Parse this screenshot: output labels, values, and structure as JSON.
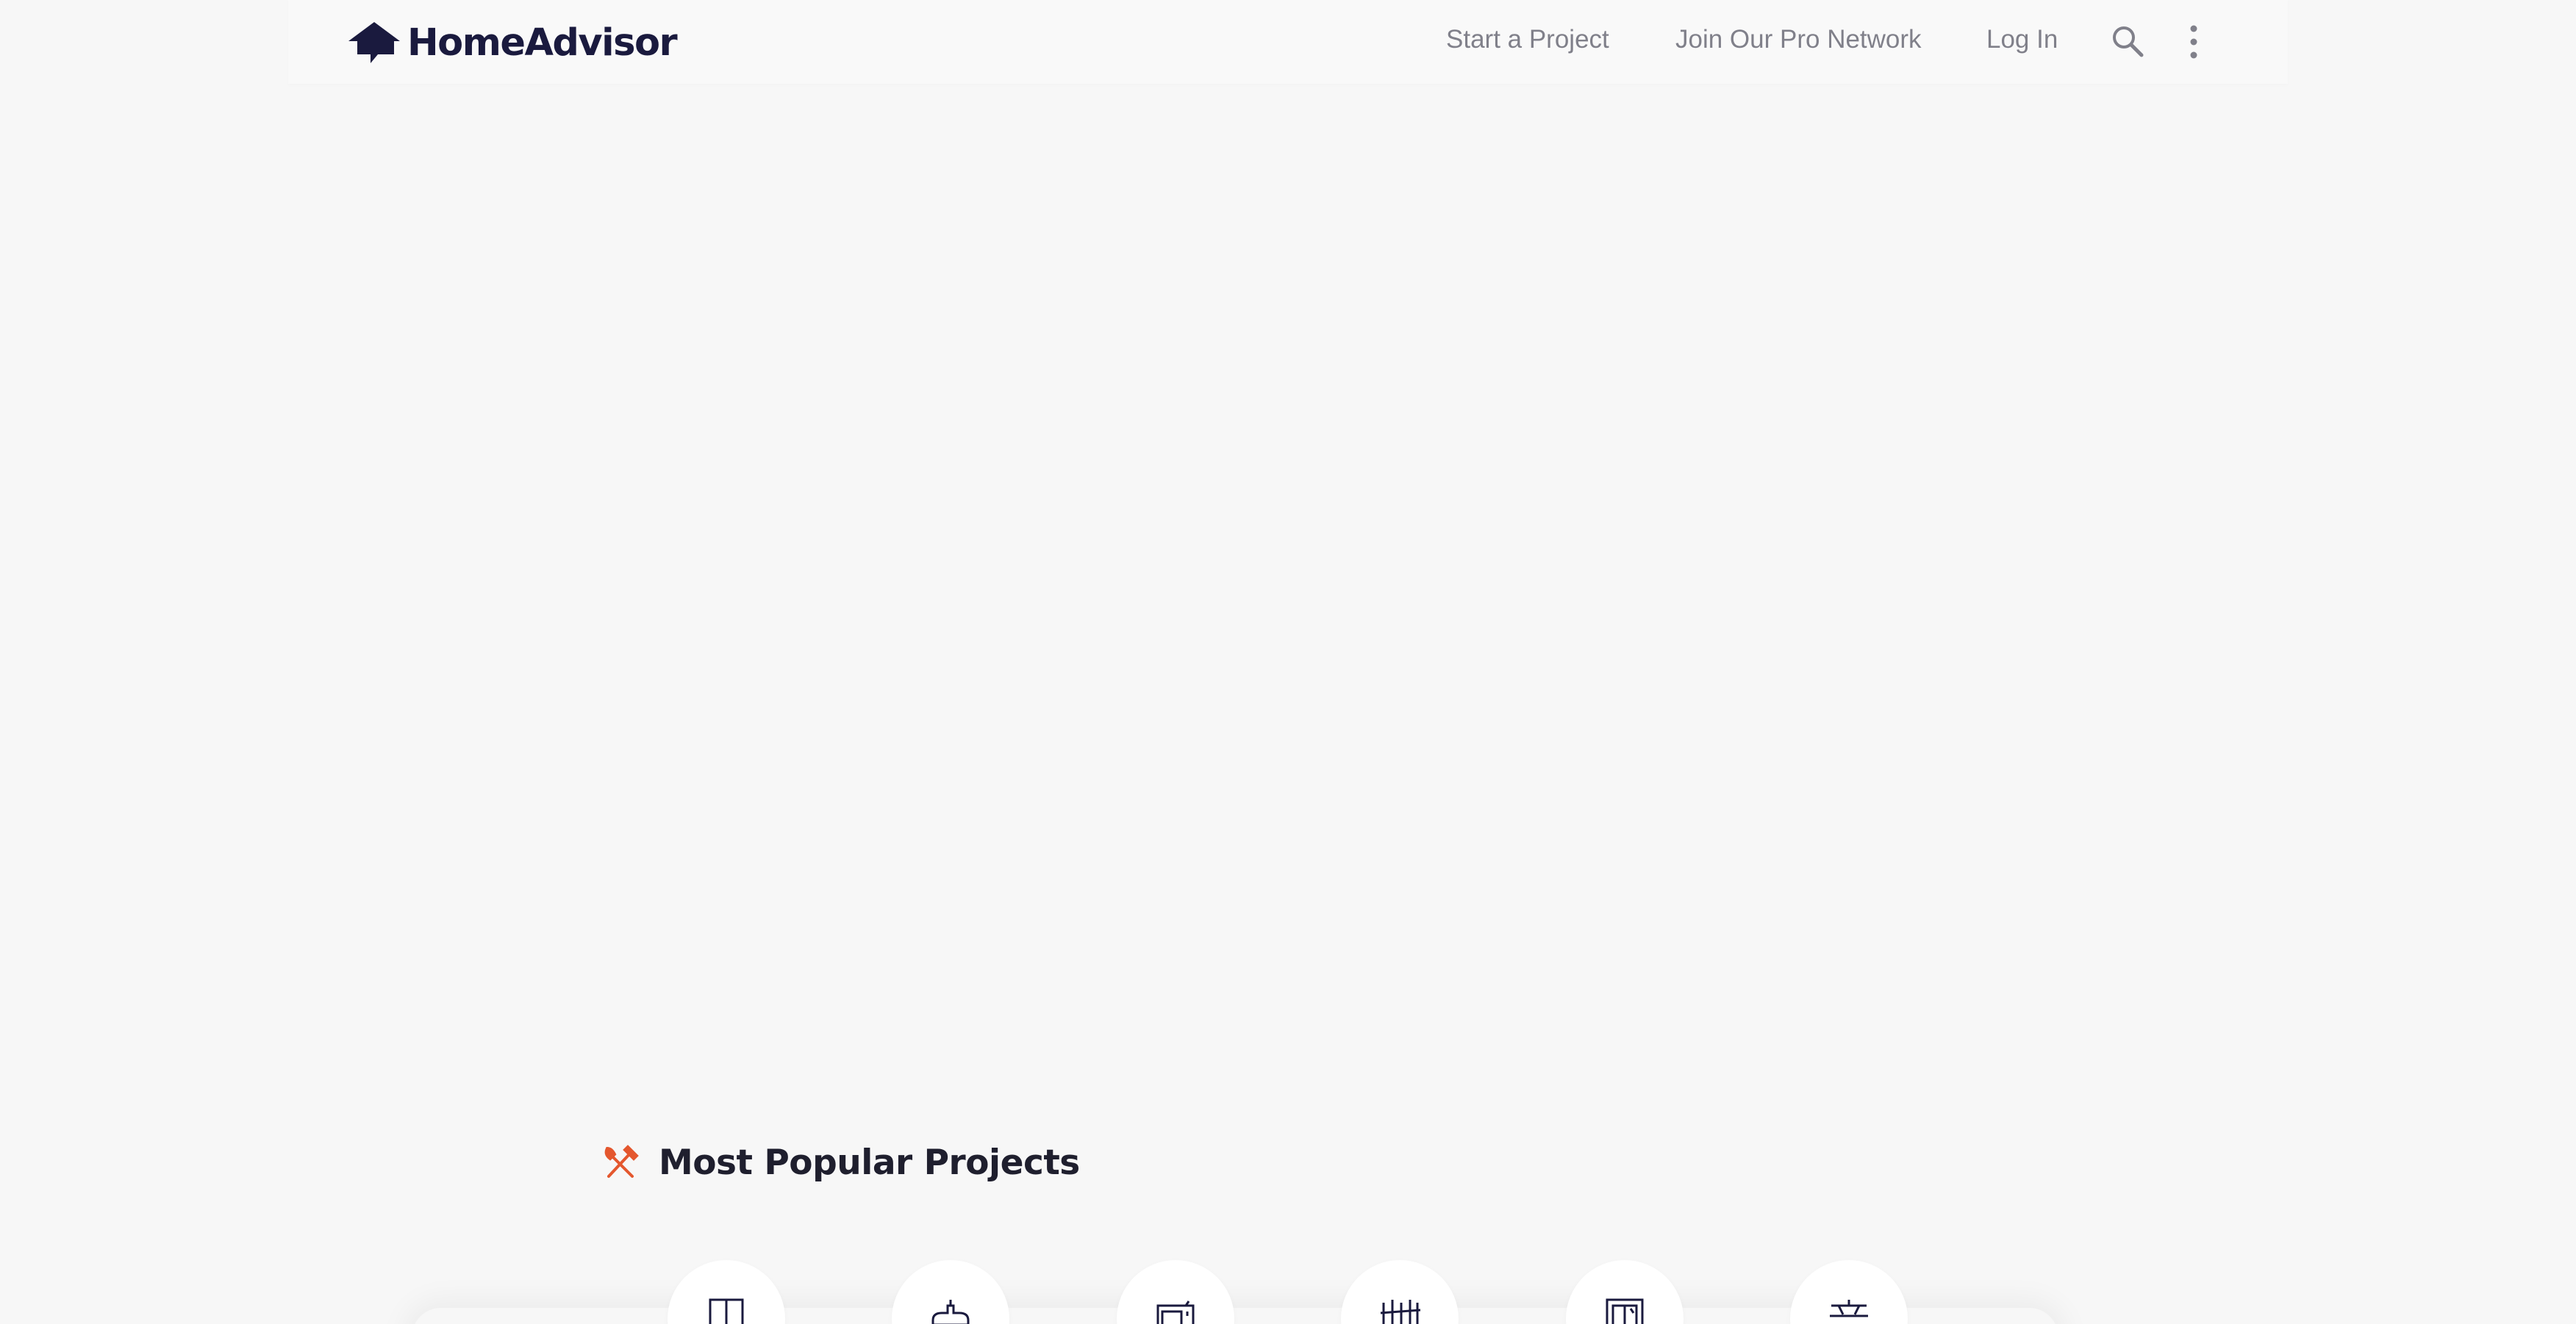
{
  "header": {
    "logo_text": "HomeAdvisor",
    "nav": {
      "start_project": "Start a Project",
      "join_pro": "Join Our Pro Network",
      "login": "Log In"
    },
    "search_icon": "search-icon",
    "more_icon": "vertical-dots-icon"
  },
  "popular": {
    "title": "Most Popular Projects",
    "icon": "tools-icon",
    "items": [
      {
        "icon": "door-icon"
      },
      {
        "icon": "plumbing-icon"
      },
      {
        "icon": "appliance-icon"
      },
      {
        "icon": "fence-icon"
      },
      {
        "icon": "window-icon"
      },
      {
        "icon": "roof-icon"
      }
    ]
  },
  "colors": {
    "brand_navy": "#1a1a3e",
    "accent_orange": "#e4572e",
    "nav_gray": "#80808a",
    "background": "#f7f7f7"
  }
}
